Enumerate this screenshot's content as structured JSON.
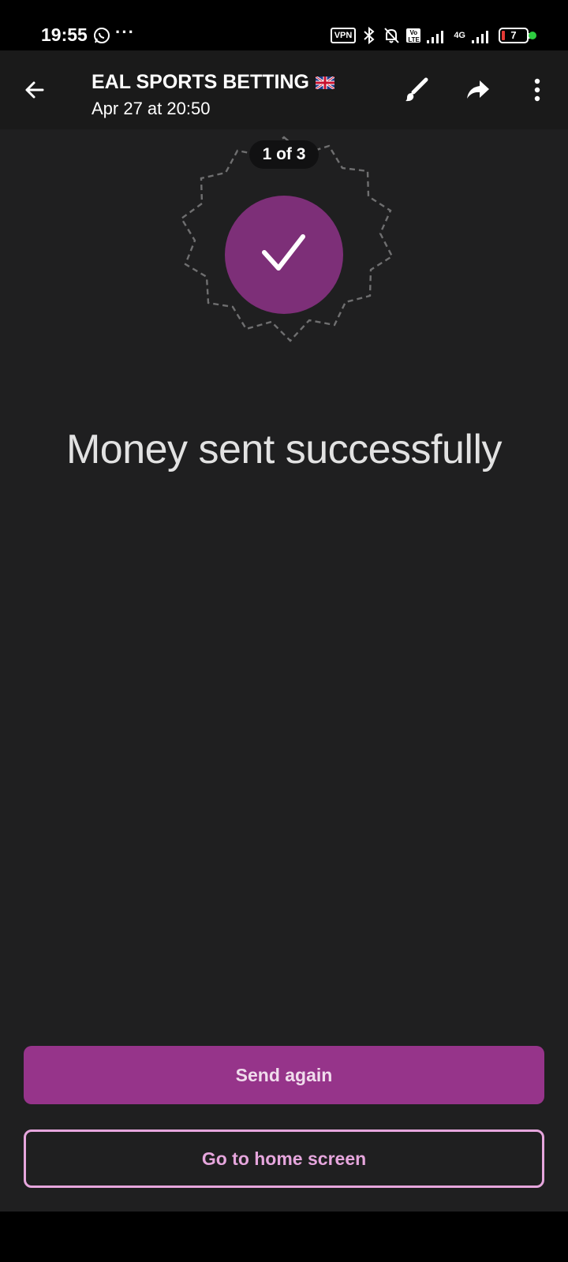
{
  "status_bar": {
    "time": "19:55",
    "more": "···",
    "vpn": "VPN",
    "volte": "Vo LTE",
    "network": "4G",
    "battery": "7",
    "dot_color": "#2ecc40"
  },
  "header": {
    "title": "EAL SPORTS BETTING",
    "subtitle": "Apr 27 at 20:50",
    "icons": [
      "back-arrow-icon",
      "uk-flag-icon",
      "brush-icon",
      "share-icon",
      "more-vert-icon"
    ]
  },
  "viewer": {
    "page_counter": "1 of 3"
  },
  "main": {
    "message": "Money sent successfully",
    "accent_color": "#96348a",
    "buttons": {
      "send_again": "Send again",
      "home": "Go to home screen"
    }
  }
}
